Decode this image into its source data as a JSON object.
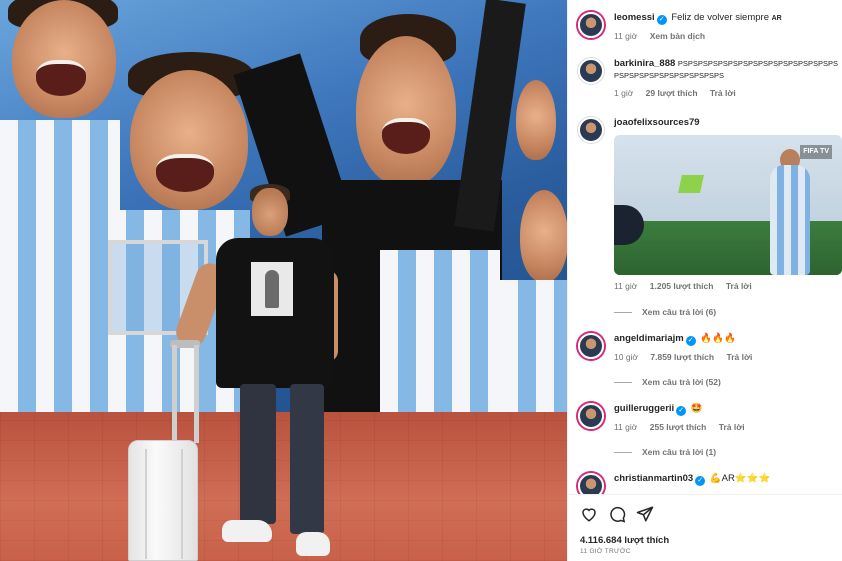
{
  "post": {
    "likes_count": "4.116.684 lượt thích",
    "posted_time": "11 GIỜ TRƯỚC"
  },
  "caption": {
    "username": "leomessi",
    "text": "Feliz de volver siempre",
    "flag": "AR",
    "time": "11 giờ",
    "translate_label": "Xem bản dịch"
  },
  "comments": [
    {
      "username": "barkinira_888",
      "text": "PSPSPSPSPSPSPSPSPSPSPSPSPSPSPSPSPSPSPSPSPSPSPSPSPSPSPS",
      "time": "1 giờ",
      "likes": "29 lượt thích",
      "reply": "Trả lời"
    },
    {
      "username": "joaofelixsources79",
      "text": "",
      "video_badge": "FIFA TV",
      "time": "11 giờ",
      "likes": "1.205 lượt thích",
      "reply": "Trả lời",
      "view_replies": "Xem câu trả lời (6)"
    },
    {
      "username": "angeldimariajm",
      "text": "🔥🔥🔥",
      "time": "10 giờ",
      "likes": "7.859 lượt thích",
      "reply": "Trả lời",
      "view_replies": "Xem câu trả lời (52)"
    },
    {
      "username": "guilleruggerii",
      "text": "🤩",
      "time": "11 giờ",
      "likes": "255 lượt thích",
      "reply": "Trả lời",
      "view_replies": "Xem câu trả lời (1)"
    },
    {
      "username": "christianmartin03",
      "text": "💪AR⭐⭐⭐"
    }
  ],
  "icons": [
    "heart-icon",
    "comment-icon",
    "share-icon"
  ],
  "colors": {
    "verified": "#0095f6",
    "muted_text": "#737373",
    "primary_text": "#262626"
  }
}
